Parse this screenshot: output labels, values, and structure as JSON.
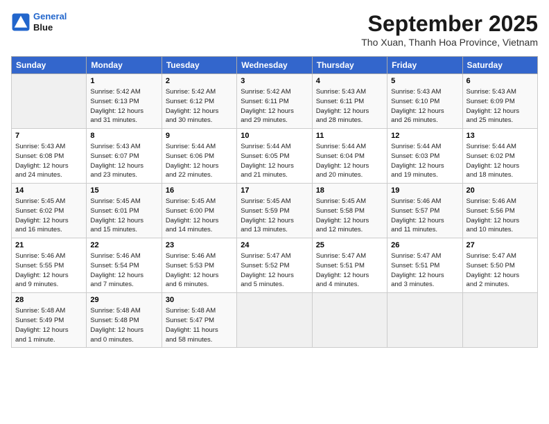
{
  "header": {
    "logo_line1": "General",
    "logo_line2": "Blue",
    "month_title": "September 2025",
    "location": "Tho Xuan, Thanh Hoa Province, Vietnam"
  },
  "days_of_week": [
    "Sunday",
    "Monday",
    "Tuesday",
    "Wednesday",
    "Thursday",
    "Friday",
    "Saturday"
  ],
  "weeks": [
    [
      {
        "day": "",
        "info": ""
      },
      {
        "day": "1",
        "info": "Sunrise: 5:42 AM\nSunset: 6:13 PM\nDaylight: 12 hours\nand 31 minutes."
      },
      {
        "day": "2",
        "info": "Sunrise: 5:42 AM\nSunset: 6:12 PM\nDaylight: 12 hours\nand 30 minutes."
      },
      {
        "day": "3",
        "info": "Sunrise: 5:42 AM\nSunset: 6:11 PM\nDaylight: 12 hours\nand 29 minutes."
      },
      {
        "day": "4",
        "info": "Sunrise: 5:43 AM\nSunset: 6:11 PM\nDaylight: 12 hours\nand 28 minutes."
      },
      {
        "day": "5",
        "info": "Sunrise: 5:43 AM\nSunset: 6:10 PM\nDaylight: 12 hours\nand 26 minutes."
      },
      {
        "day": "6",
        "info": "Sunrise: 5:43 AM\nSunset: 6:09 PM\nDaylight: 12 hours\nand 25 minutes."
      }
    ],
    [
      {
        "day": "7",
        "info": "Sunrise: 5:43 AM\nSunset: 6:08 PM\nDaylight: 12 hours\nand 24 minutes."
      },
      {
        "day": "8",
        "info": "Sunrise: 5:43 AM\nSunset: 6:07 PM\nDaylight: 12 hours\nand 23 minutes."
      },
      {
        "day": "9",
        "info": "Sunrise: 5:44 AM\nSunset: 6:06 PM\nDaylight: 12 hours\nand 22 minutes."
      },
      {
        "day": "10",
        "info": "Sunrise: 5:44 AM\nSunset: 6:05 PM\nDaylight: 12 hours\nand 21 minutes."
      },
      {
        "day": "11",
        "info": "Sunrise: 5:44 AM\nSunset: 6:04 PM\nDaylight: 12 hours\nand 20 minutes."
      },
      {
        "day": "12",
        "info": "Sunrise: 5:44 AM\nSunset: 6:03 PM\nDaylight: 12 hours\nand 19 minutes."
      },
      {
        "day": "13",
        "info": "Sunrise: 5:44 AM\nSunset: 6:02 PM\nDaylight: 12 hours\nand 18 minutes."
      }
    ],
    [
      {
        "day": "14",
        "info": "Sunrise: 5:45 AM\nSunset: 6:02 PM\nDaylight: 12 hours\nand 16 minutes."
      },
      {
        "day": "15",
        "info": "Sunrise: 5:45 AM\nSunset: 6:01 PM\nDaylight: 12 hours\nand 15 minutes."
      },
      {
        "day": "16",
        "info": "Sunrise: 5:45 AM\nSunset: 6:00 PM\nDaylight: 12 hours\nand 14 minutes."
      },
      {
        "day": "17",
        "info": "Sunrise: 5:45 AM\nSunset: 5:59 PM\nDaylight: 12 hours\nand 13 minutes."
      },
      {
        "day": "18",
        "info": "Sunrise: 5:45 AM\nSunset: 5:58 PM\nDaylight: 12 hours\nand 12 minutes."
      },
      {
        "day": "19",
        "info": "Sunrise: 5:46 AM\nSunset: 5:57 PM\nDaylight: 12 hours\nand 11 minutes."
      },
      {
        "day": "20",
        "info": "Sunrise: 5:46 AM\nSunset: 5:56 PM\nDaylight: 12 hours\nand 10 minutes."
      }
    ],
    [
      {
        "day": "21",
        "info": "Sunrise: 5:46 AM\nSunset: 5:55 PM\nDaylight: 12 hours\nand 9 minutes."
      },
      {
        "day": "22",
        "info": "Sunrise: 5:46 AM\nSunset: 5:54 PM\nDaylight: 12 hours\nand 7 minutes."
      },
      {
        "day": "23",
        "info": "Sunrise: 5:46 AM\nSunset: 5:53 PM\nDaylight: 12 hours\nand 6 minutes."
      },
      {
        "day": "24",
        "info": "Sunrise: 5:47 AM\nSunset: 5:52 PM\nDaylight: 12 hours\nand 5 minutes."
      },
      {
        "day": "25",
        "info": "Sunrise: 5:47 AM\nSunset: 5:51 PM\nDaylight: 12 hours\nand 4 minutes."
      },
      {
        "day": "26",
        "info": "Sunrise: 5:47 AM\nSunset: 5:51 PM\nDaylight: 12 hours\nand 3 minutes."
      },
      {
        "day": "27",
        "info": "Sunrise: 5:47 AM\nSunset: 5:50 PM\nDaylight: 12 hours\nand 2 minutes."
      }
    ],
    [
      {
        "day": "28",
        "info": "Sunrise: 5:48 AM\nSunset: 5:49 PM\nDaylight: 12 hours\nand 1 minute."
      },
      {
        "day": "29",
        "info": "Sunrise: 5:48 AM\nSunset: 5:48 PM\nDaylight: 12 hours\nand 0 minutes."
      },
      {
        "day": "30",
        "info": "Sunrise: 5:48 AM\nSunset: 5:47 PM\nDaylight: 11 hours\nand 58 minutes."
      },
      {
        "day": "",
        "info": ""
      },
      {
        "day": "",
        "info": ""
      },
      {
        "day": "",
        "info": ""
      },
      {
        "day": "",
        "info": ""
      }
    ]
  ]
}
